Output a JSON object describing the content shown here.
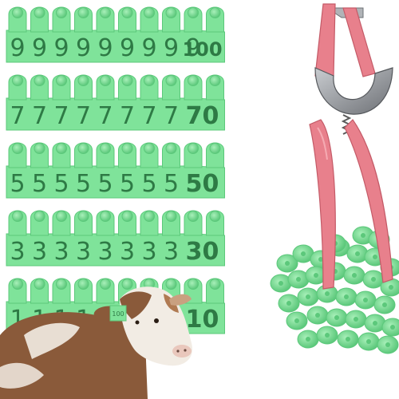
{
  "product": {
    "tag_rows": [
      {
        "number": "9",
        "last_number": "100"
      },
      {
        "number": "7",
        "last_number": "70"
      },
      {
        "number": "5",
        "last_number": "50"
      },
      {
        "number": "3",
        "last_number": "30"
      },
      {
        "number": "1",
        "last_number": "10"
      }
    ],
    "calf_tag_number": "100",
    "colors": {
      "tag_green": "#7fe39a",
      "tag_green_dark": "#5cc87b",
      "tag_number": "#2e7a45",
      "plier_handle": "#e8808c",
      "plier_metal": "#8c8f93",
      "calf_brown": "#8a5a3a",
      "calf_white": "#f2ece4"
    },
    "icons": [
      "ear-tag-icon",
      "tag-applicator-pliers-icon",
      "calf-icon"
    ]
  }
}
